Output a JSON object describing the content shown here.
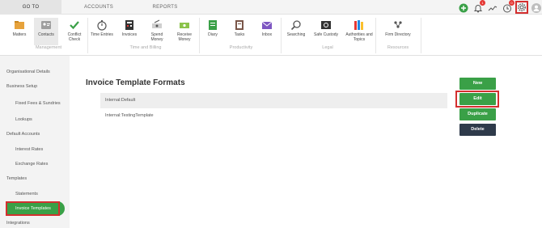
{
  "topnav": {
    "tabs": [
      {
        "label": "GO TO",
        "active": true
      },
      {
        "label": "ACCOUNTS",
        "active": false
      },
      {
        "label": "REPORTS",
        "active": false
      }
    ],
    "notification_badge": "1",
    "timer_badge": "0",
    "icons": [
      "add-circle-icon",
      "bell-icon",
      "activity-icon",
      "timer-icon",
      "gear-icon",
      "user-icon"
    ]
  },
  "ribbon": {
    "groups": [
      {
        "label": "Management",
        "items": [
          {
            "label": "Matters",
            "icon": "matters-icon"
          },
          {
            "label": "Contacts",
            "icon": "contacts-icon"
          },
          {
            "label": "Conflict Check",
            "icon": "check-icon"
          }
        ]
      },
      {
        "label": "Time and Billing",
        "items": [
          {
            "label": "Time Entries",
            "icon": "stopwatch-icon"
          },
          {
            "label": "Invoices",
            "icon": "invoice-icon"
          },
          {
            "label": "Spend Money",
            "icon": "spend-icon"
          },
          {
            "label": "Receive Money",
            "icon": "receive-icon"
          }
        ]
      },
      {
        "label": "Productivity",
        "items": [
          {
            "label": "Diary",
            "icon": "diary-icon"
          },
          {
            "label": "Tasks",
            "icon": "tasks-icon"
          },
          {
            "label": "Inbox",
            "icon": "inbox-icon"
          }
        ]
      },
      {
        "label": "Legal",
        "items": [
          {
            "label": "Searching",
            "icon": "search-icon"
          },
          {
            "label": "Safe Custody",
            "icon": "safe-icon"
          },
          {
            "label": "Authorities and Topics",
            "icon": "books-icon"
          }
        ]
      },
      {
        "label": "Resources",
        "items": [
          {
            "label": "Firm Directory",
            "icon": "directory-icon"
          }
        ]
      }
    ]
  },
  "sidebar": {
    "items": [
      {
        "label": "Organisational Details",
        "level": 1
      },
      {
        "label": "Business Setup",
        "level": 1
      },
      {
        "label": "Fixed Fees & Sundries",
        "level": 2
      },
      {
        "label": "Lookups",
        "level": 2
      },
      {
        "label": "Default Accounts",
        "level": 1
      },
      {
        "label": "Interest Rates",
        "level": 2
      },
      {
        "label": "Exchange Rates",
        "level": 2
      },
      {
        "label": "Templates",
        "level": 1
      },
      {
        "label": "Statements",
        "level": 2
      },
      {
        "label": "Invoice Templates",
        "level": 2,
        "active": true
      },
      {
        "label": "Integrations",
        "level": 1
      }
    ]
  },
  "main": {
    "title": "Invoice Template Formats",
    "templates": [
      {
        "label": "Internal:Default",
        "selected": true
      },
      {
        "label": "Internal:TestingTemplate",
        "selected": false
      }
    ]
  },
  "actions": {
    "new": "New",
    "edit": "Edit",
    "duplicate": "Duplicate",
    "delete": "Delete"
  },
  "colors": {
    "accent_green": "#3aa047",
    "dark_button": "#2e3a4a",
    "highlight_red": "#d32f2f"
  }
}
